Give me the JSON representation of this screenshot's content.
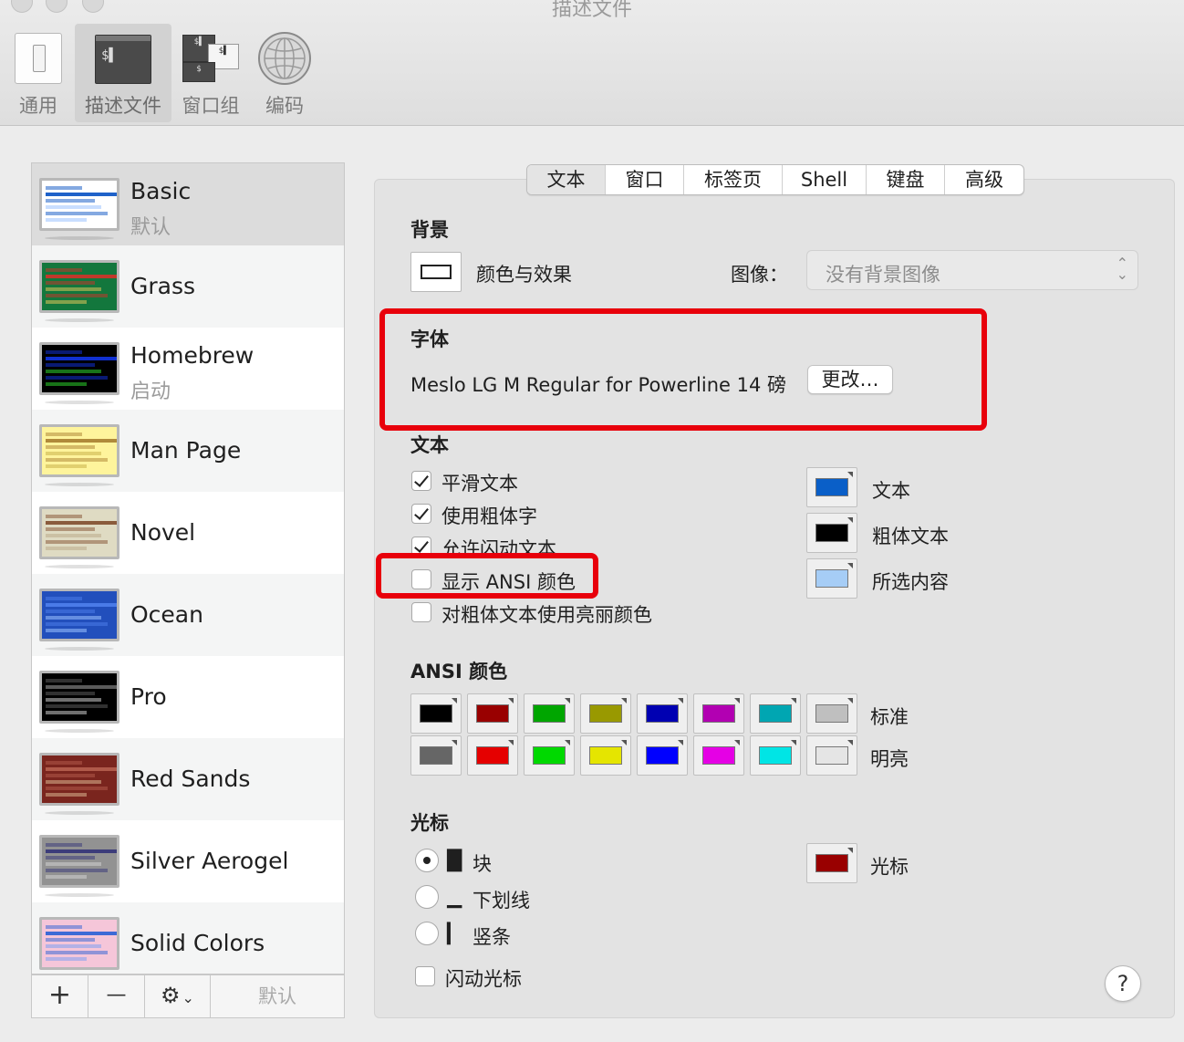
{
  "window": {
    "title": "描述文件"
  },
  "toolbar": {
    "items": [
      {
        "label": "通用"
      },
      {
        "label": "描述文件"
      },
      {
        "label": "窗口组"
      },
      {
        "label": "编码"
      }
    ]
  },
  "profiles": [
    {
      "name": "Basic",
      "subtitle": "默认",
      "bg": "#ffffff",
      "bar": "#1f62c9",
      "accent": "#9cc3ff"
    },
    {
      "name": "Grass",
      "subtitle": "",
      "bg": "#13773d",
      "bar": "#c0392b",
      "accent": "#e0c55a"
    },
    {
      "name": "Homebrew",
      "subtitle": "启动",
      "bg": "#000000",
      "bar": "#1030d0",
      "accent": "#2bd12b"
    },
    {
      "name": "Man Page",
      "subtitle": "",
      "bg": "#fef49c",
      "bar": "#b08a3a",
      "accent": "#c9b34a"
    },
    {
      "name": "Novel",
      "subtitle": "",
      "bg": "#dfdbc3",
      "bar": "#8a5b3c",
      "accent": "#b9a98a"
    },
    {
      "name": "Ocean",
      "subtitle": "",
      "bg": "#224fbc",
      "bar": "#4a7be8",
      "accent": "#9cc3ff"
    },
    {
      "name": "Pro",
      "subtitle": "",
      "bg": "#000000",
      "bar": "#5a5a5a",
      "accent": "#cccccc"
    },
    {
      "name": "Red Sands",
      "subtitle": "",
      "bg": "#7a251e",
      "bar": "#b05a4a",
      "accent": "#d9b48f"
    },
    {
      "name": "Silver Aerogel",
      "subtitle": "",
      "bg": "#929292",
      "bar": "#3c3c7a",
      "accent": "#cfcfcf"
    },
    {
      "name": "Solid Colors",
      "subtitle": "",
      "bg": "#f5c6d9",
      "bar": "#3d6ad6",
      "accent": "#7ea1f0"
    }
  ],
  "list_footer": {
    "add": "+",
    "remove": "—",
    "gear": "⚙",
    "gear_chevron": "⌄",
    "default_label": "默认"
  },
  "tabs": [
    {
      "label": "文本"
    },
    {
      "label": "窗口"
    },
    {
      "label": "标签页"
    },
    {
      "label": "Shell"
    },
    {
      "label": "键盘"
    },
    {
      "label": "高级"
    }
  ],
  "background": {
    "title": "背景",
    "color_effects_label": "颜色与效果",
    "image_label": "图像：",
    "image_value": "没有背景图像"
  },
  "font": {
    "title": "字体",
    "value": "Meslo LG M Regular for Powerline 14 磅",
    "change_button": "更改…"
  },
  "text": {
    "title": "文本",
    "options": [
      {
        "label": "平滑文本",
        "checked": true
      },
      {
        "label": "使用粗体字",
        "checked": true
      },
      {
        "label": "允许闪动文本",
        "checked": true
      },
      {
        "label": "显示 ANSI 颜色",
        "checked": false
      },
      {
        "label": "对粗体文本使用亮丽颜色",
        "checked": false
      }
    ],
    "colors": [
      {
        "label": "文本",
        "color": "#0a5fc8"
      },
      {
        "label": "粗体文本",
        "color": "#000000"
      },
      {
        "label": "所选内容",
        "color": "#a6cdf6"
      }
    ]
  },
  "ansi": {
    "title": "ANSI 颜色",
    "normal_label": "标准",
    "bright_label": "明亮",
    "normal": [
      "#000000",
      "#990000",
      "#00a600",
      "#999900",
      "#0000b2",
      "#b200b2",
      "#00a6b2",
      "#bfbfbf"
    ],
    "bright": [
      "#666666",
      "#e50000",
      "#00d900",
      "#e5e500",
      "#0000ff",
      "#e500e5",
      "#00e5e5",
      "#e5e5e5"
    ]
  },
  "cursor": {
    "title": "光标",
    "options": [
      {
        "glyph": "█",
        "label": "块",
        "selected": true
      },
      {
        "glyph": "▁",
        "label": "下划线",
        "selected": false
      },
      {
        "glyph": "▎",
        "label": "竖条",
        "selected": false
      }
    ],
    "blink_label": "闪动光标",
    "color_label": "光标",
    "color": "#990000"
  },
  "help": "?"
}
